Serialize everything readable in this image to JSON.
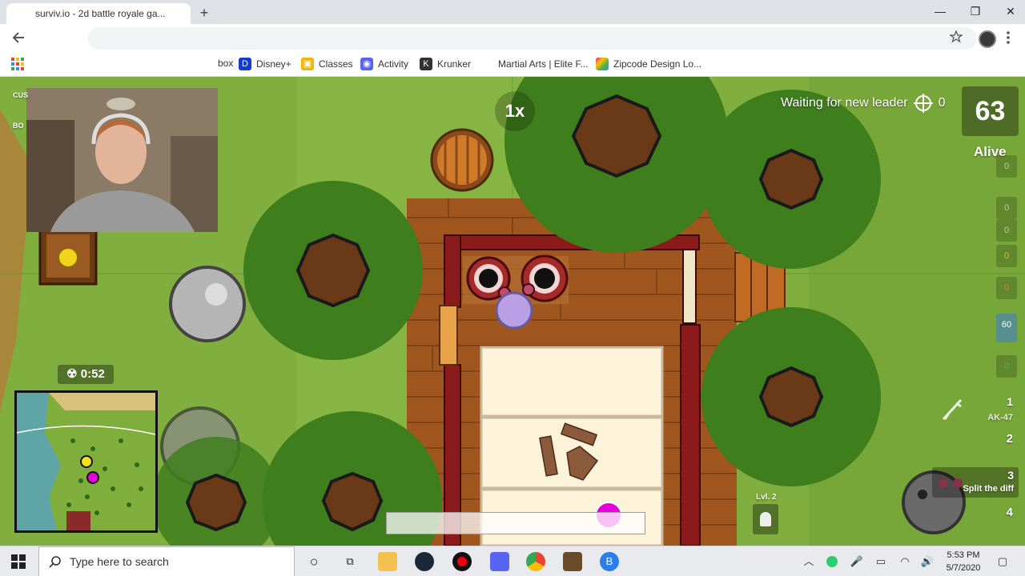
{
  "browser": {
    "tab_title": "surviv.io - 2d battle royale ga...",
    "new_tab_icon": "+",
    "window_controls": [
      "—",
      "❐",
      "✕"
    ],
    "bookmarks": [
      {
        "label": "box",
        "icon": "bookmark-icon",
        "color": "#888888"
      },
      {
        "label": "Disney+",
        "icon": "disney-icon",
        "color": "#113ccf"
      },
      {
        "label": "Classes",
        "icon": "classes-icon",
        "color": "#f4b400"
      },
      {
        "label": "Activity",
        "icon": "discord-icon",
        "color": "#5865f2"
      },
      {
        "label": "Krunker",
        "icon": "krunker-icon",
        "color": "#333333"
      },
      {
        "label": "Martial Arts | Elite F...",
        "icon": "blank-icon",
        "color": "#ffffff"
      },
      {
        "label": "Zipcode Design Lo...",
        "icon": "zipcode-icon",
        "color": "#9c27b0"
      }
    ]
  },
  "game": {
    "zoom": "1x",
    "leader_text": "Waiting for new leader",
    "kills": "0",
    "alive_count": "63",
    "alive_label": "Alive",
    "gas_timer": "0:52",
    "side_slots": [
      {
        "value": "0",
        "color": "#aaaaaa"
      },
      {
        "value": "0",
        "color": "#aaaaaa"
      },
      {
        "value": "0",
        "color": "#aaaaaa"
      },
      {
        "value": "0",
        "color": "#d4b93a"
      },
      {
        "value": "0",
        "color": "#c9853d"
      },
      {
        "value": "60",
        "color": "#3a7bd5"
      },
      {
        "value": "0",
        "color": "#5fae4a"
      }
    ],
    "weapons": [
      {
        "slot": "1",
        "name": "AK-47"
      },
      {
        "slot": "2",
        "name": ""
      },
      {
        "slot": "3",
        "name": "Split the diff"
      },
      {
        "slot": "4",
        "name": ""
      }
    ],
    "helmet_level": "Lvl. 2",
    "tag_a": "CUS",
    "tag_b": "BO"
  },
  "taskbar": {
    "search_placeholder": "Type here to search",
    "time": "5:53 PM",
    "date": "5/7/2020"
  },
  "colors": {
    "grass": "#7fae3d",
    "tree": "#3f7e1d",
    "wood": "#a0521d",
    "brick": "#8b3a12",
    "accent_pink": "#e600d9"
  }
}
